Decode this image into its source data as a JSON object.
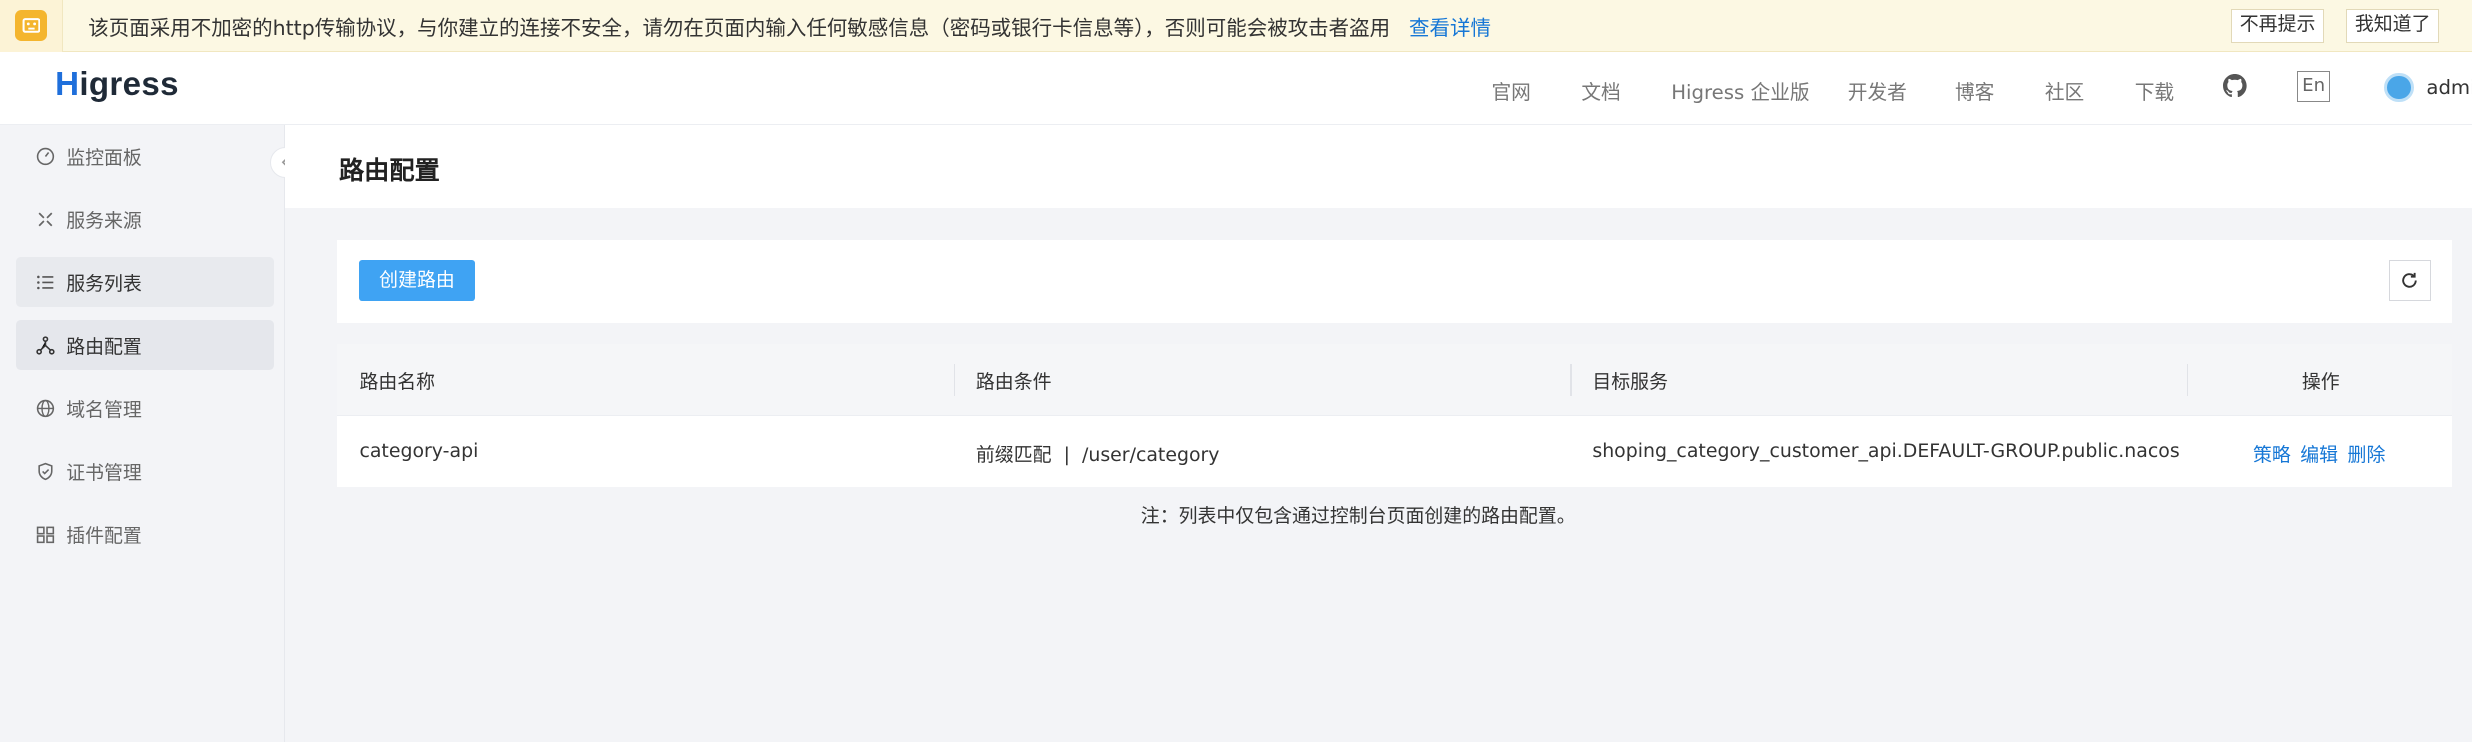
{
  "warning": {
    "text": "该页面采用不加密的http传输协议，与你建立的连接不安全，请勿在页面内输入任何敏感信息（密码或银行卡信息等），否则可能会被攻击者盗用",
    "detail_link": "查看详情",
    "dismiss_button": "不再提示",
    "ack_button": "我知道了"
  },
  "header": {
    "logo_first": "H",
    "logo_rest": "igress",
    "nav": [
      "官网",
      "文档",
      "Higress 企业版",
      "开发者",
      "博客",
      "社区",
      "下载"
    ],
    "lang": "En",
    "user": "admin"
  },
  "sidebar": {
    "items": [
      {
        "label": "监控面板",
        "icon": "dashboard-icon"
      },
      {
        "label": "服务来源",
        "icon": "service-source-icon"
      },
      {
        "label": "服务列表",
        "icon": "list-icon"
      },
      {
        "label": "路由配置",
        "icon": "route-icon"
      },
      {
        "label": "域名管理",
        "icon": "globe-icon"
      },
      {
        "label": "证书管理",
        "icon": "shield-check-icon"
      },
      {
        "label": "插件配置",
        "icon": "plugin-icon"
      }
    ],
    "active_index": 3,
    "hover_index": 2
  },
  "main": {
    "title": "路由配置",
    "create_button": "创建路由",
    "table": {
      "columns": [
        "路由名称",
        "路由条件",
        "目标服务",
        "操作"
      ],
      "rows": [
        {
          "name": "category-api",
          "condition_type": "前缀匹配",
          "condition_sep": "|",
          "condition_path": "/user/category",
          "target": "shoping_category_customer_api.DEFAULT-GROUP.public.nacos",
          "actions": [
            "策略",
            "编辑",
            "删除"
          ]
        }
      ]
    },
    "note": "注：列表中仅包含通过控制台页面创建的路由配置。"
  }
}
